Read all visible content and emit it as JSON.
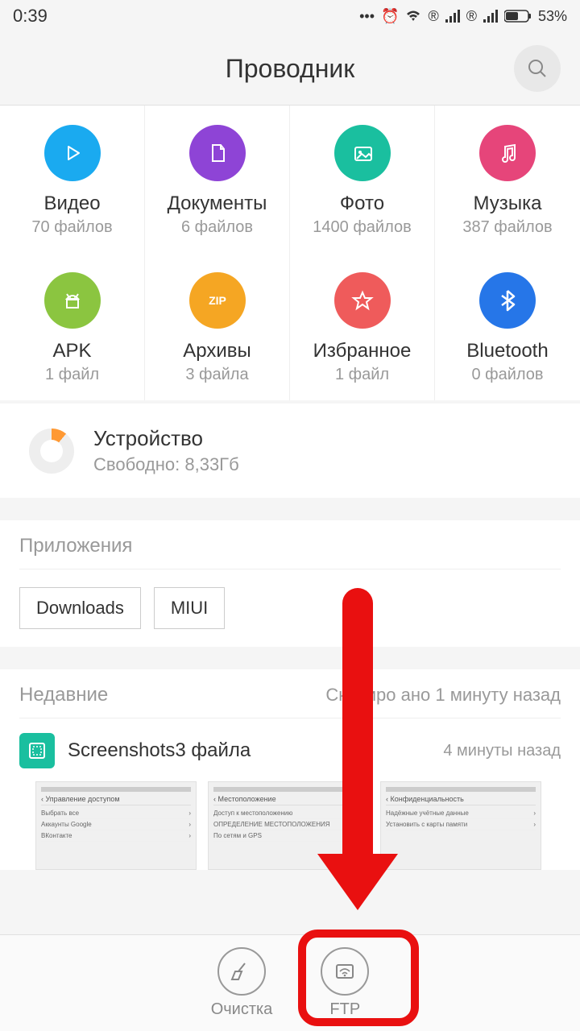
{
  "status": {
    "time": "0:39",
    "battery": "53%",
    "registered": "®"
  },
  "header": {
    "title": "Проводник"
  },
  "categories": [
    {
      "id": "video",
      "title": "Видео",
      "sub": "70 файлов",
      "color": "#1aaaf0",
      "icon": "play"
    },
    {
      "id": "docs",
      "title": "Документы",
      "sub": "6 файлов",
      "color": "#8e44d6",
      "icon": "doc"
    },
    {
      "id": "photo",
      "title": "Фото",
      "sub": "1400 файлов",
      "color": "#1abf9f",
      "icon": "image"
    },
    {
      "id": "music",
      "title": "Музыка",
      "sub": "387 файлов",
      "color": "#e6457a",
      "icon": "music"
    },
    {
      "id": "apk",
      "title": "APK",
      "sub": "1 файл",
      "color": "#8bc540",
      "icon": "android"
    },
    {
      "id": "zip",
      "title": "Архивы",
      "sub": "3 файла",
      "color": "#f5a623",
      "icon": "zip"
    },
    {
      "id": "fav",
      "title": "Избранное",
      "sub": "1 файл",
      "color": "#ef5b5b",
      "icon": "star"
    },
    {
      "id": "bt",
      "title": "Bluetooth",
      "sub": "0 файлов",
      "color": "#2676e8",
      "icon": "bluetooth"
    }
  ],
  "storage": {
    "title": "Устройство",
    "sub": "Свободно: 8,33Гб"
  },
  "apps": {
    "title": "Приложения",
    "items": [
      "Downloads",
      "MIUI"
    ]
  },
  "recent": {
    "title": "Недавние",
    "scan": "Сканиро  ано 1 минуту назад",
    "item": {
      "title": "Screenshots3 файла",
      "time": "4 минуты назад"
    },
    "thumbs": [
      {
        "hdr": "Управление доступом",
        "rows": [
          "Выбрать все",
          "Аккаунты Google",
          "ВКонтакте"
        ]
      },
      {
        "hdr": "Местоположение",
        "rows": [
          "Доступ к местоположению",
          "ОПРЕДЕЛЕНИЕ МЕСТОПОЛОЖЕНИЯ",
          "По сетям и GPS"
        ]
      },
      {
        "hdr": "Конфиденциальность",
        "rows": [
          "Надёжные учётные данные",
          "Установить с карты памяти"
        ]
      }
    ]
  },
  "bottom": [
    {
      "id": "clean",
      "label": "Очистка",
      "icon": "broom"
    },
    {
      "id": "ftp",
      "label": "FTP",
      "icon": "wifi-box"
    }
  ]
}
